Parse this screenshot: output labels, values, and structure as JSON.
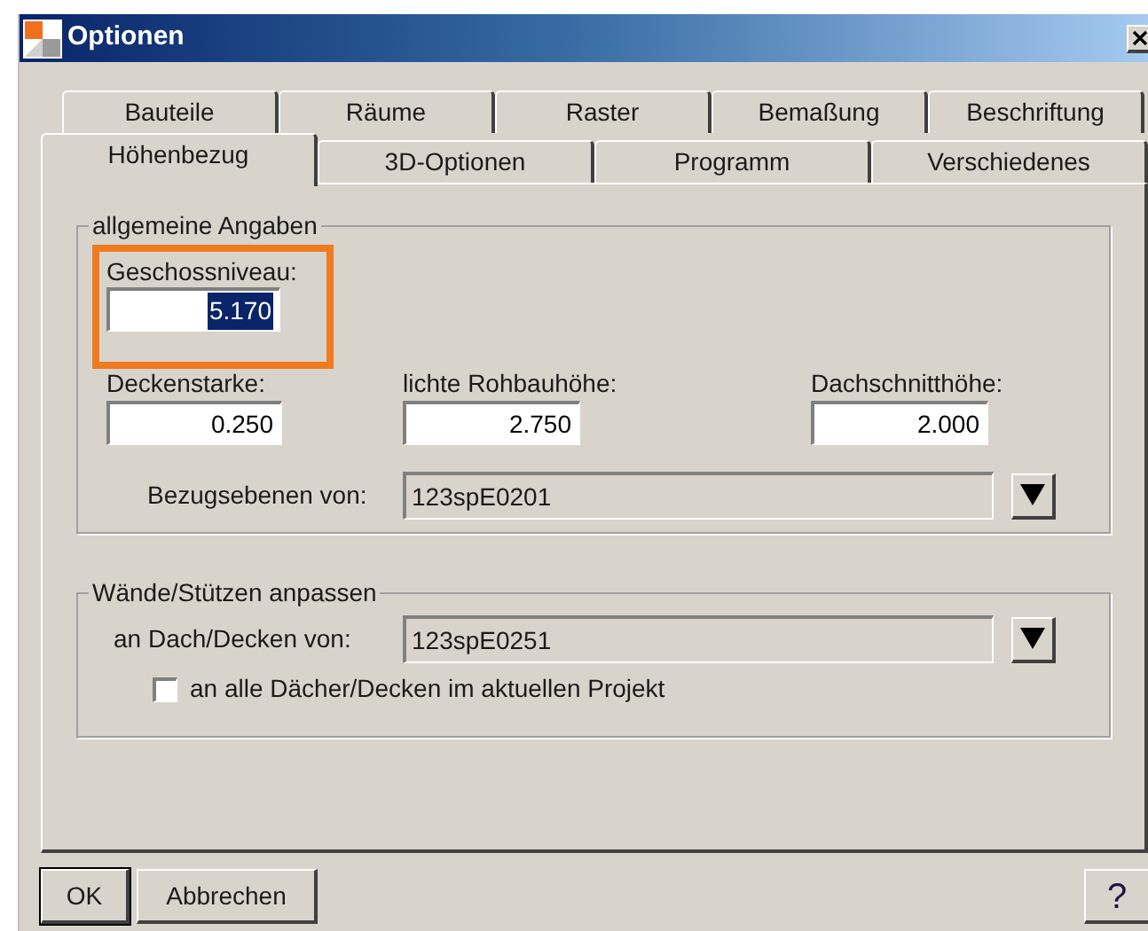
{
  "window": {
    "title": "Optionen"
  },
  "tab_rows": [
    {
      "tabs": [
        {
          "label": "Bauteile",
          "selected": false
        },
        {
          "label": "Räume",
          "selected": false
        },
        {
          "label": "Raster",
          "selected": false
        },
        {
          "label": "Bemaßung",
          "selected": false
        },
        {
          "label": "Beschriftung",
          "selected": false
        }
      ]
    },
    {
      "tabs": [
        {
          "label": "Höhenbezug",
          "selected": true
        },
        {
          "label": "3D-Optionen",
          "selected": false
        },
        {
          "label": "Programm",
          "selected": false
        },
        {
          "label": "Verschiedenes",
          "selected": false
        }
      ]
    }
  ],
  "general": {
    "title": "allgemeine Angaben",
    "level_field": {
      "label": "Geschossniveau:",
      "value": "5.170",
      "text_selected": true,
      "highlighted": true
    },
    "fields": [
      {
        "label": "Deckenstarke:",
        "value": "0.250",
        "text_selected": false
      },
      {
        "label": "lichte Rohbauhöhe:",
        "value": "2.750",
        "text_selected": false
      },
      {
        "label": "Dachschnitthöhe:",
        "value": "2.000",
        "text_selected": false
      }
    ],
    "reference": {
      "label": "Bezugsebenen von:",
      "value": "123spE0201"
    }
  },
  "walls": {
    "title": "Wände/Stützen anpassen",
    "reference": {
      "label": "an Dach/Decken von:",
      "value": "123spE0251"
    },
    "checkbox": {
      "label": "an alle Dächer/Decken im aktuellen Projekt",
      "checked": false
    }
  },
  "buttons": [
    {
      "label": "OK",
      "default": true
    },
    {
      "label": "Abbrechen",
      "default": false
    }
  ],
  "help": "?"
}
